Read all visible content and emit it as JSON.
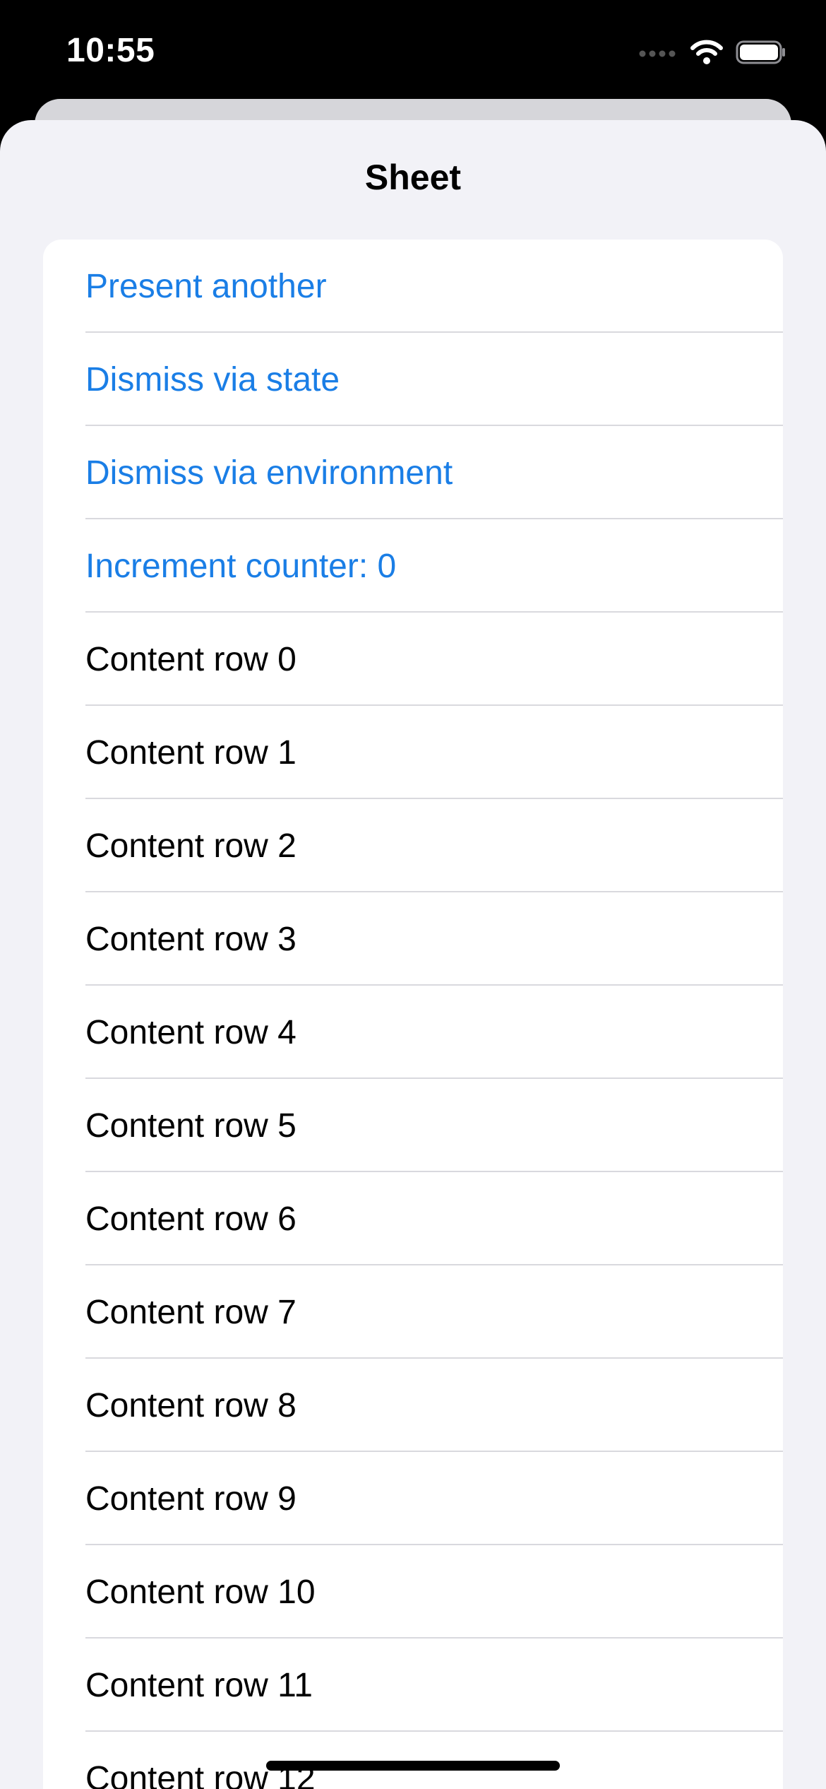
{
  "status_bar": {
    "time": "10:55"
  },
  "sheet": {
    "title": "Sheet"
  },
  "actions": [
    {
      "label": "Present another"
    },
    {
      "label": "Dismiss via state"
    },
    {
      "label": "Dismiss via environment"
    },
    {
      "label": "Increment counter: 0"
    }
  ],
  "content_rows": [
    {
      "label": "Content row 0"
    },
    {
      "label": "Content row 1"
    },
    {
      "label": "Content row 2"
    },
    {
      "label": "Content row 3"
    },
    {
      "label": "Content row 4"
    },
    {
      "label": "Content row 5"
    },
    {
      "label": "Content row 6"
    },
    {
      "label": "Content row 7"
    },
    {
      "label": "Content row 8"
    },
    {
      "label": "Content row 9"
    },
    {
      "label": "Content row 10"
    },
    {
      "label": "Content row 11"
    },
    {
      "label": "Content row 12"
    }
  ],
  "colors": {
    "accent": "#1a7ee6",
    "sheet_background": "#f2f2f7",
    "status_bar": "#000000"
  },
  "icons": [
    "cellular-signal-icon",
    "wifi-icon",
    "battery-icon"
  ]
}
